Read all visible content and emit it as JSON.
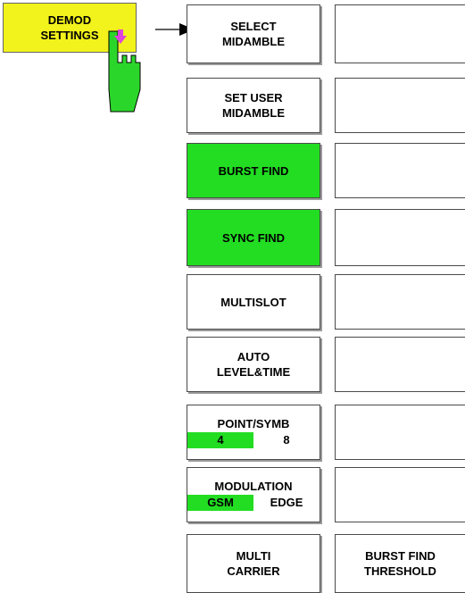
{
  "demod_settings": {
    "line1": "DEMOD",
    "line2": "SETTINGS"
  },
  "softkeys": [
    {
      "line1": "SELECT",
      "line2": "MIDAMBLE"
    },
    {
      "line1": "SET  USER",
      "line2": "MIDAMBLE"
    },
    {
      "line1": "BURST FIND",
      "active": true
    },
    {
      "line1": "SYNC FIND",
      "active": true
    },
    {
      "line1": "MULTISLOT"
    },
    {
      "line1": "AUTO",
      "line2": "LEVEL&TIME"
    },
    {
      "line1": "POINT/SYMB",
      "options": [
        "4",
        "8"
      ],
      "selected": "4"
    },
    {
      "line1": "MODULATION",
      "options": [
        "GSM",
        "EDGE"
      ],
      "selected": "GSM"
    },
    {
      "line1": "MULTI",
      "line2": "CARRIER"
    }
  ],
  "right_softkeys": [
    {
      "line1": "BURST FIND",
      "line2": "THRESHOLD"
    }
  ],
  "colors": {
    "active": "#22dd22",
    "menu_key": "#f2f21c",
    "pointer_arrow": "#cc33cc"
  },
  "icons": [
    "hand-pointer-icon",
    "pink-down-arrow-icon",
    "navigation-arrow-icon"
  ]
}
